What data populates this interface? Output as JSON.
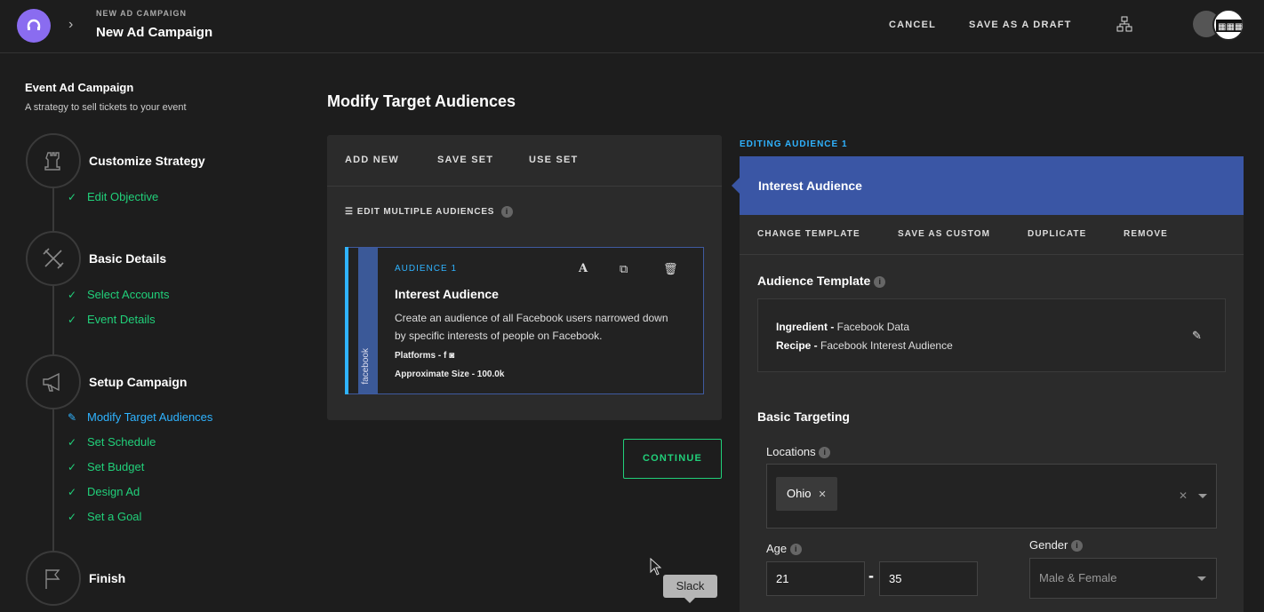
{
  "header": {
    "breadcrumb_small": "NEW AD CAMPAIGN",
    "title": "New Ad Campaign",
    "cancel": "CANCEL",
    "save_draft": "SAVE AS A DRAFT",
    "logo_icon": "headphones-icon",
    "org_icon": "org-chart-icon",
    "accent": "#8a6cf0"
  },
  "sidebar": {
    "title": "Event Ad Campaign",
    "subtitle": "A strategy to sell tickets to your event",
    "steps": [
      {
        "label": "Customize Strategy",
        "icon": "rook-icon",
        "items": [
          {
            "label": "Edit Objective",
            "status": "done"
          }
        ]
      },
      {
        "label": "Basic Details",
        "icon": "tools-icon",
        "items": [
          {
            "label": "Select Accounts",
            "status": "done"
          },
          {
            "label": "Event Details",
            "status": "done"
          }
        ]
      },
      {
        "label": "Setup Campaign",
        "icon": "megaphone-icon",
        "items": [
          {
            "label": "Modify Target Audiences",
            "status": "active"
          },
          {
            "label": "Set Schedule",
            "status": "done"
          },
          {
            "label": "Set Budget",
            "status": "done"
          },
          {
            "label": "Design Ad",
            "status": "done"
          },
          {
            "label": "Set a Goal",
            "status": "done"
          }
        ]
      },
      {
        "label": "Finish",
        "icon": "flag-icon",
        "items": []
      }
    ]
  },
  "main": {
    "title": "Modify Target Audiences",
    "tabs": [
      "ADD NEW",
      "SAVE SET",
      "USE SET"
    ],
    "edit_multiple": "EDIT MULTIPLE AUDIENCES",
    "card": {
      "label": "AUDIENCE 1",
      "title": "Interest Audience",
      "description": "Create an audience of all Facebook users narrowed down by specific interests of people on Facebook.",
      "platforms": "Platforms - ",
      "size": "Approximate Size - 100.0k",
      "strip": "facebook"
    },
    "continue": "CONTINUE"
  },
  "editor": {
    "label": "EDITING AUDIENCE 1",
    "title": "Interest Audience",
    "actions": [
      "CHANGE TEMPLATE",
      "SAVE AS CUSTOM",
      "DUPLICATE",
      "REMOVE"
    ],
    "template_title": "Audience Template",
    "ingredient_key": "Ingredient - ",
    "ingredient_val": "Facebook Data",
    "recipe_key": "Recipe - ",
    "recipe_val": "Facebook Interest Audience",
    "basic_targeting": "Basic Targeting",
    "locations_label": "Locations",
    "location_chip": "Ohio",
    "age_label": "Age",
    "age_min": "21",
    "age_max": "35",
    "gender_label": "Gender",
    "gender_value": "Male & Female"
  },
  "tooltip": "Slack"
}
